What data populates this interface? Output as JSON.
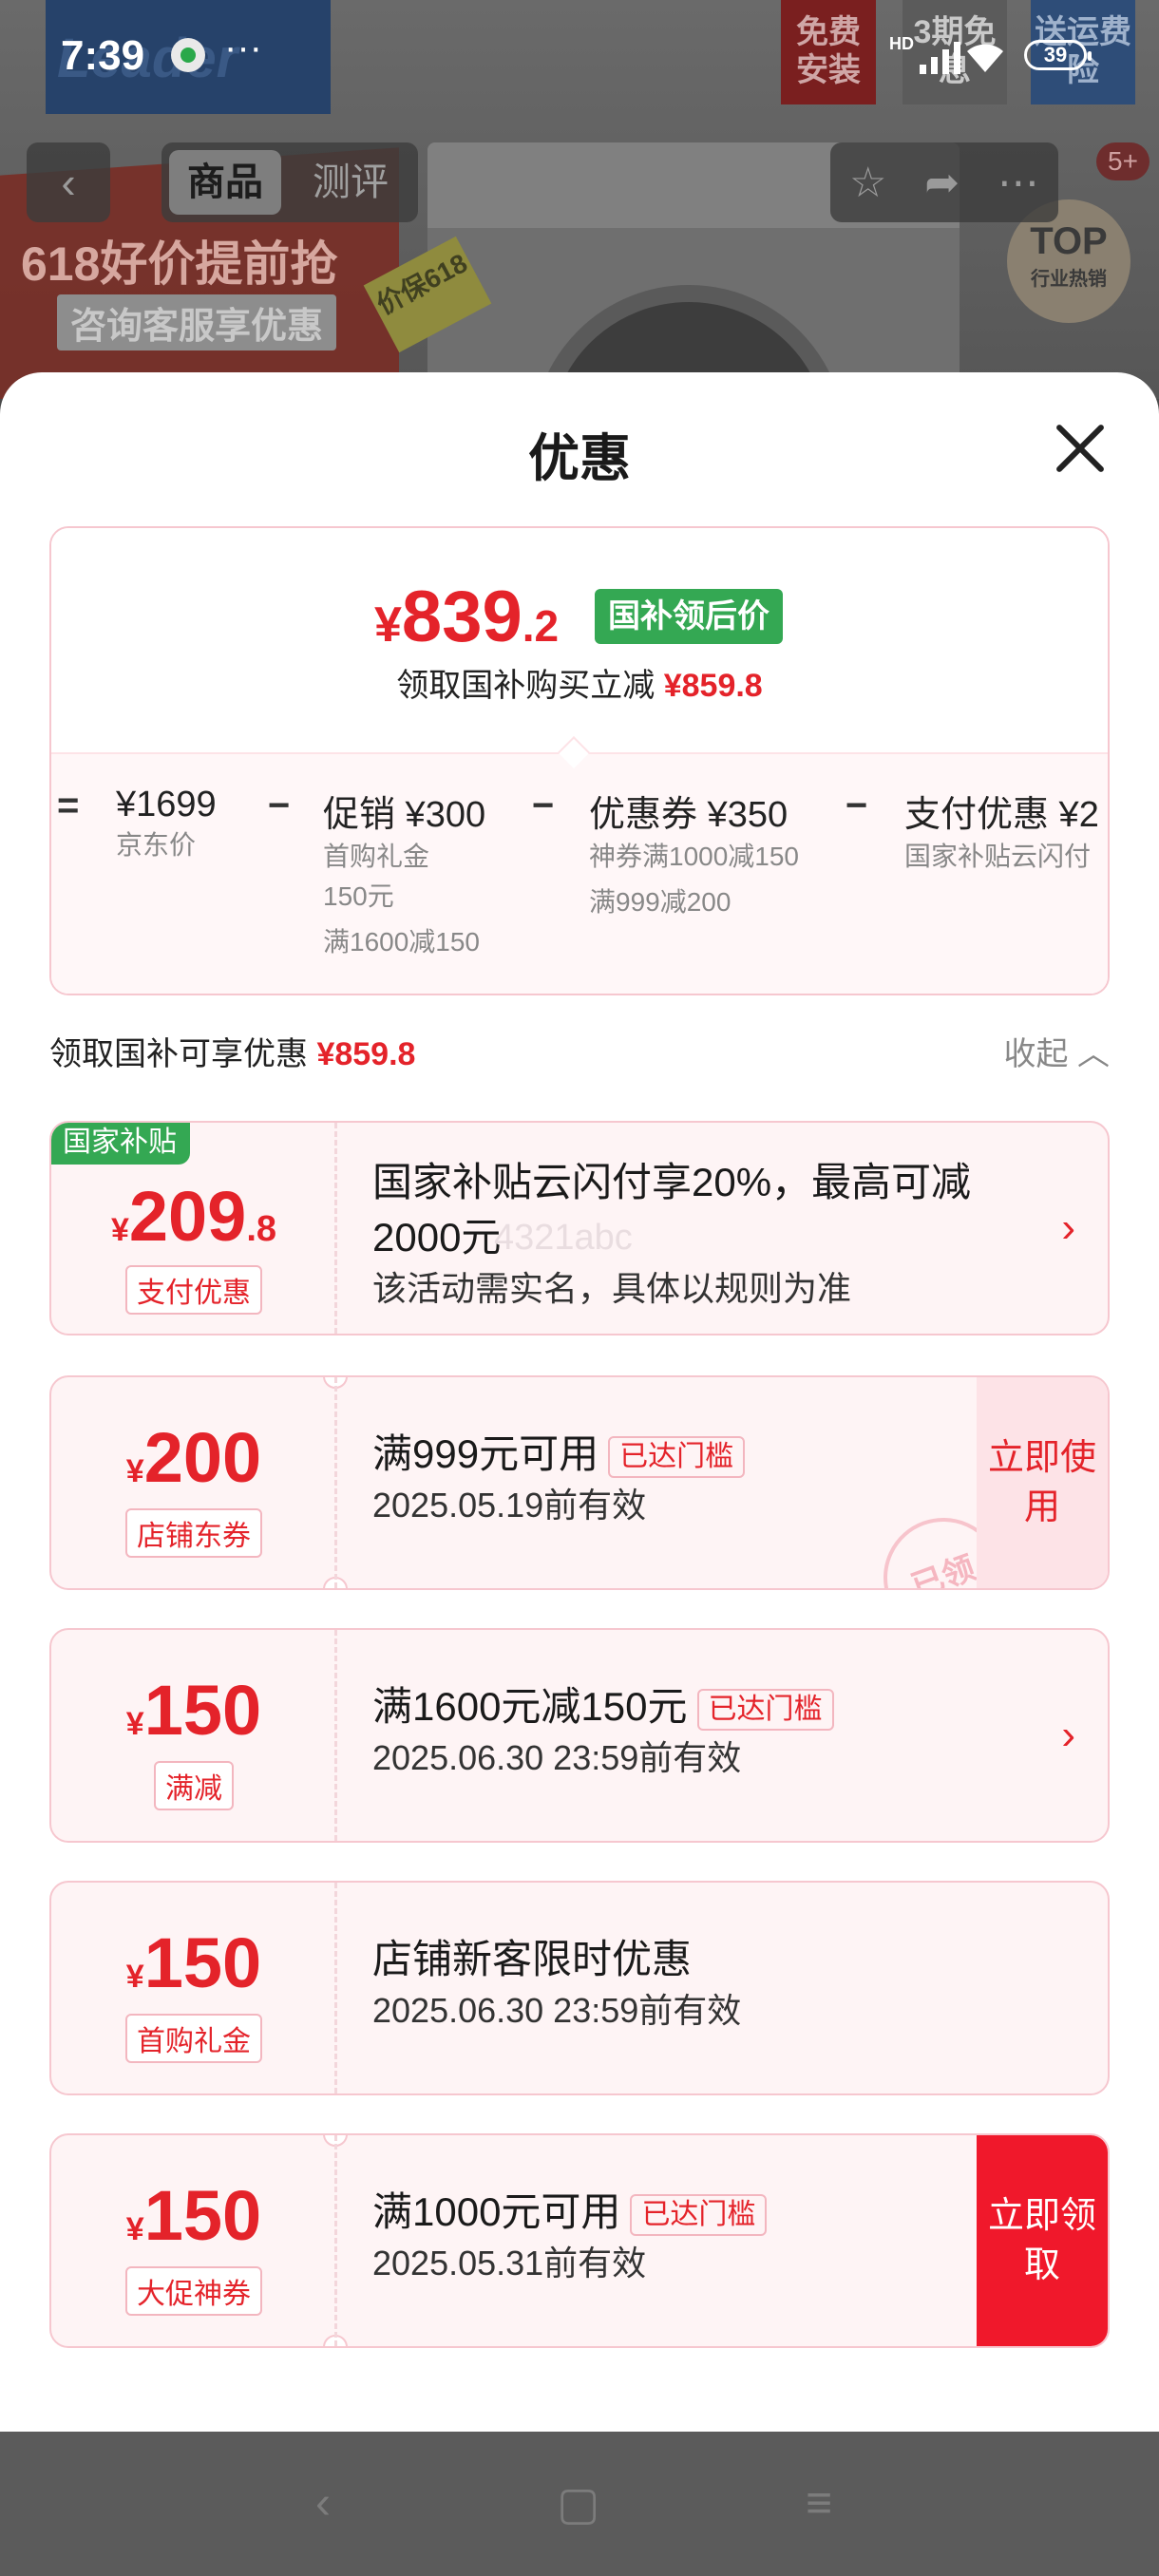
{
  "status_bar": {
    "time": "7:39",
    "dots": "···",
    "network": "HD",
    "battery": "39"
  },
  "background": {
    "brand": "Leader",
    "promo_line1": "618好价提前抢",
    "promo_line2": "咨询客服享优惠",
    "price_guard": "价保618",
    "tag_free_install": "免费安装",
    "tag_3_period": "3期免息",
    "tag_insurance": "送运费险",
    "top_badge": "TOP",
    "top_badge_sub": "行业热销"
  },
  "nav": {
    "back_icon": "chevron-left-icon",
    "tabs": [
      "商品",
      "测评"
    ],
    "badge": "5+"
  },
  "sheet": {
    "title": "优惠",
    "summary": {
      "currency": "¥",
      "price_int": "839",
      "price_dec": ".2",
      "tag": "国补领后价",
      "line_label": "领取国补购买立减",
      "line_amount": "¥859.8",
      "equals": "=",
      "minus": "−",
      "items": [
        {
          "main": "¥1699",
          "subs": [
            "京东价"
          ]
        },
        {
          "main": "促销 ¥300",
          "subs": [
            "首购礼金",
            "150元",
            "满1600减150"
          ]
        },
        {
          "main": "优惠券 ¥350",
          "subs": [
            "神券满1000减150",
            "满999减200"
          ]
        },
        {
          "main": "支付优惠 ¥2",
          "subs": [
            "国家补贴云闪付"
          ]
        }
      ]
    },
    "section": {
      "label": "领取国补可享优惠",
      "amount": "¥859.8",
      "collapse": "收起"
    },
    "coupons": [
      {
        "badge": "国家补贴",
        "currency": "¥",
        "int": "209",
        "dec": ".8",
        "tag": "支付优惠",
        "title": "国家补贴云闪付享20%，最高可减2000元",
        "sub": "该活动需实名，具体以规则为准",
        "action": "arrow"
      },
      {
        "currency": "¥",
        "int": "200",
        "dec": "",
        "tag": "店铺东券",
        "title": "满999元可用",
        "met": "已达门槛",
        "sub": "2025.05.19前有效",
        "action": "立即使用",
        "stamp": "已领"
      },
      {
        "currency": "¥",
        "int": "150",
        "dec": "",
        "tag": "满减",
        "title": "满1600元减150元",
        "met": "已达门槛",
        "sub": "2025.06.30 23:59前有效",
        "action": "arrow"
      },
      {
        "currency": "¥",
        "int": "150",
        "dec": "",
        "tag": "首购礼金",
        "title": "店铺新客限时优惠",
        "sub": "2025.06.30 23:59前有效"
      },
      {
        "currency": "¥",
        "int": "150",
        "dec": "",
        "tag": "大促神券",
        "title": "满1000元可用",
        "met": "已达门槛",
        "sub": "2025.05.31前有效",
        "action": "立即领取"
      }
    ],
    "watermark": "4321abc"
  },
  "system_nav": {
    "back": "‹",
    "home": "▢",
    "menu": "≡"
  },
  "colors": {
    "accent_red": "#e4232a",
    "green_tag": "#34a853",
    "claim_red": "#f0182b"
  }
}
